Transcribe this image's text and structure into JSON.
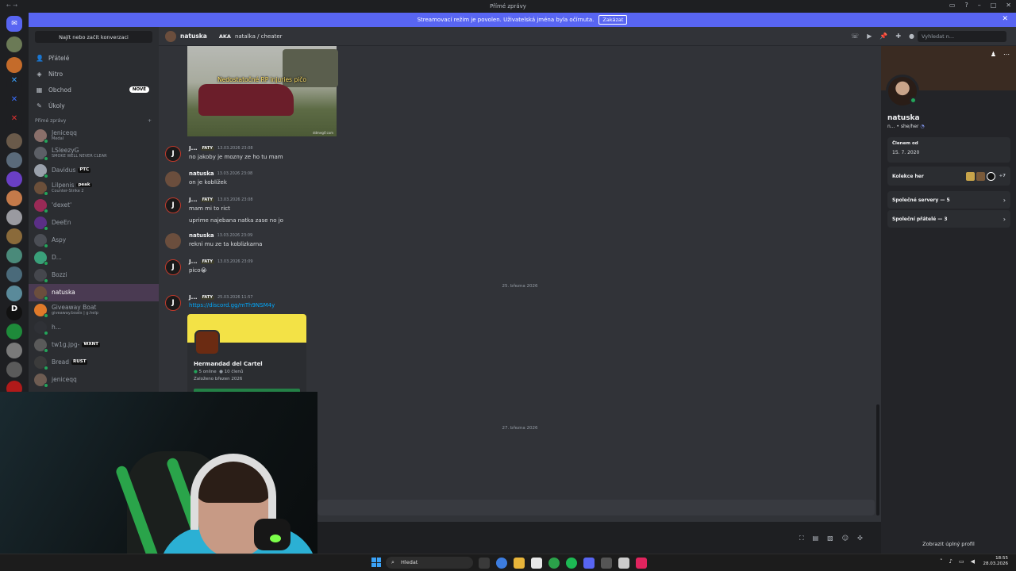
{
  "window": {
    "title": "Přímé zprávy"
  },
  "banner": {
    "text": "Streamovací režim je povolen. Uživatelská jména byla očírnuta.",
    "disable_label": "Zakázat"
  },
  "sidebar": {
    "find_label": "Najít nebo začít konverzaci",
    "nav": [
      {
        "label": "Přátelé"
      },
      {
        "label": "Nitro"
      },
      {
        "label": "Obchod",
        "badge": "NOVÉ"
      },
      {
        "label": "Úkoly"
      }
    ],
    "dm_header": "Přímé zprávy",
    "dms": [
      {
        "name": "Jeniceqq",
        "sub": "Medal",
        "color": "#8a6f6a"
      },
      {
        "name": "LSleezyG",
        "sub": "SMOKE WELL NEVER CLEAR",
        "color": "#5c5f66"
      },
      {
        "name": "Davidus",
        "tag": "PTC",
        "color": "#9aa1ac"
      },
      {
        "name": "Lilpenis",
        "tag": "peak",
        "sub": "Counter-Strike 2",
        "color": "#6b4f3a"
      },
      {
        "name": "'dexet'",
        "color": "#9a2a56"
      },
      {
        "name": "DeeEn",
        "color": "#5b2f86"
      },
      {
        "name": "Aspy",
        "color": "#4b4e55"
      },
      {
        "name": "D...",
        "color": "#3aa07a"
      },
      {
        "name": "Bozzi",
        "color": "#45474d"
      },
      {
        "name": "natuska",
        "color": "#6b4e3d",
        "selected": true
      },
      {
        "name": "Giveaway Boat",
        "sub": "giveaway.boats | g.help",
        "color": "#e07a2a"
      },
      {
        "name": "h...",
        "color": "#2f3136"
      },
      {
        "name": "tw1g.jpg-",
        "tag": "WXNT",
        "color": "#5a5a5a"
      },
      {
        "name": "Bread",
        "tag": "RUST",
        "color": "#3b3b3b"
      },
      {
        "name": "jeniceqq",
        "color": "#6e5c52"
      }
    ]
  },
  "chat": {
    "name": "natuska",
    "aka_label": "AKA",
    "aka_value": "natalka / cheater",
    "search_placeholder": "Vyhledat n...",
    "gif_caption": "Nedostatočné RP injuries pičo",
    "gif_watermark": "ddmegif.com",
    "messages": [
      {
        "author": "J...",
        "tag": "FATY",
        "time": "13.03.2026 23:08",
        "lines": [
          "no jakoby je mozny ze ho tu mam"
        ]
      },
      {
        "author": "natuska",
        "time": "13.03.2026 23:08",
        "lines": [
          "on je koblížek"
        ]
      },
      {
        "author": "J...",
        "tag": "FATY",
        "time": "13.03.2026 23:08",
        "lines": [
          "mam mi to rict",
          "uprime najebana natka zase no jo"
        ]
      },
      {
        "author": "natuska",
        "time": "13.03.2026 23:09",
        "lines": [
          "rekni mu ze ta koblizkarna"
        ]
      },
      {
        "author": "J...",
        "tag": "FATY",
        "time": "13.03.2026 23:09",
        "lines": [
          "pico😭"
        ]
      },
      {
        "author": "J...",
        "tag": "FATY",
        "time": "25.03.2026 11:57",
        "link": "https://discord.gg/mTh9NSM4y"
      }
    ],
    "dividers": [
      "25. března 2026",
      "27. března 2026"
    ],
    "invite": {
      "name": "Hermandad del Cartel",
      "online": "5 online",
      "members": "10 členů",
      "founded": "Založeno březen 2026"
    }
  },
  "profile": {
    "name": "natuska",
    "sub": "n... • she/her",
    "member_since_label": "Členem od",
    "member_since": "15. 7. 2020",
    "games_label": "Kolekce her",
    "games_more": "+7",
    "mutual_servers": "Společné servery — 5",
    "mutual_friends": "Společní přátelé — 3",
    "full_profile": "Zobrazit úplný profil"
  },
  "taskbar": {
    "search": "Hledat",
    "time": "18:55",
    "date": "28.03.2026"
  },
  "colors": {
    "blurple": "#5865f2",
    "online": "#23a55a",
    "link": "#00a8fc"
  }
}
